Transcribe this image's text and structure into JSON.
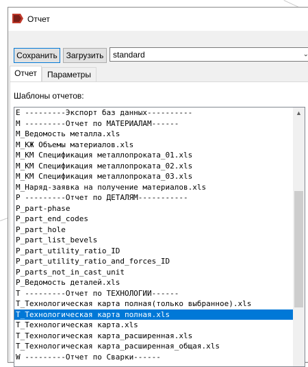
{
  "window": {
    "title": "Отчет",
    "title_icon": "report-app-icon"
  },
  "toolbar": {
    "save_label": "Сохранить",
    "load_label": "Загрузить",
    "template_value": "standard"
  },
  "tabs": [
    {
      "label": "Отчет",
      "active": true
    },
    {
      "label": "Параметры",
      "active": false
    }
  ],
  "report_tab": {
    "templates_label": "Шаблоны отчетов:",
    "selected_index": 19,
    "items": [
      "E ---------Экспорт баз данных----------",
      "M ---------Отчет по МАТЕРИАЛАМ------",
      "M_Ведомость металла.xls",
      "M_КЖ Объемы материалов.xls",
      "M_КМ Спецификация металлопроката_01.xls",
      "M_КМ Спецификация металлопроката_02.xls",
      "M_КМ Спецификация металлопроката_03.xls",
      "M_Наряд-заявка на получение материалов.xls",
      "P ---------Отчет по ДЕТАЛЯМ-----------",
      "P_part-phase",
      "P_part_end_codes",
      "P_part_hole",
      "P_part_list_bevels",
      "P_part_utility_ratio_ID",
      "P_part_utility_ratio_and_forces_ID",
      "P_parts_not_in_cast_unit",
      "P_Ведомость деталей.xls",
      "T ---------Отчет по ТЕХНОЛОГИИ------",
      "T_Технологическая карта полная(только выбранное).xls",
      "T_Технологическая карта полная.xls",
      "T_Технологическая карта.xls",
      "T_Технологическая карта_расширенная.xls",
      "T_Технологическая карта_расширенная_общая.xls",
      "W ---------Отчет по Сварки------"
    ]
  },
  "colors": {
    "selection": "#0078d7",
    "window_bg": "#f0f0f0",
    "accent_border": "#0078d7"
  }
}
